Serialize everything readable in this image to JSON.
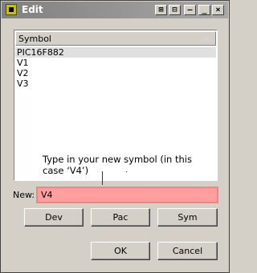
{
  "window": {
    "title": "Edit"
  },
  "list": {
    "header": "Symbol",
    "items": [
      "PIC16F882",
      "V1",
      "V2",
      "V3"
    ],
    "selected_index": 0
  },
  "annotation": {
    "line1": "Type in your new symbol (in this",
    "line2": "case ‘V4’)",
    "color": "#c00000"
  },
  "new_field": {
    "label": "New:",
    "value": "V4",
    "highlight_color": "#ffa0a0"
  },
  "buttons": {
    "dev": "Dev",
    "pac": "Pac",
    "sym": "Sym",
    "ok": "OK",
    "cancel": "Cancel"
  },
  "titlebar_buttons": {
    "pin": "⊠",
    "unpin": "⊟",
    "minimize": "—",
    "maximize": "_",
    "close": "×"
  }
}
